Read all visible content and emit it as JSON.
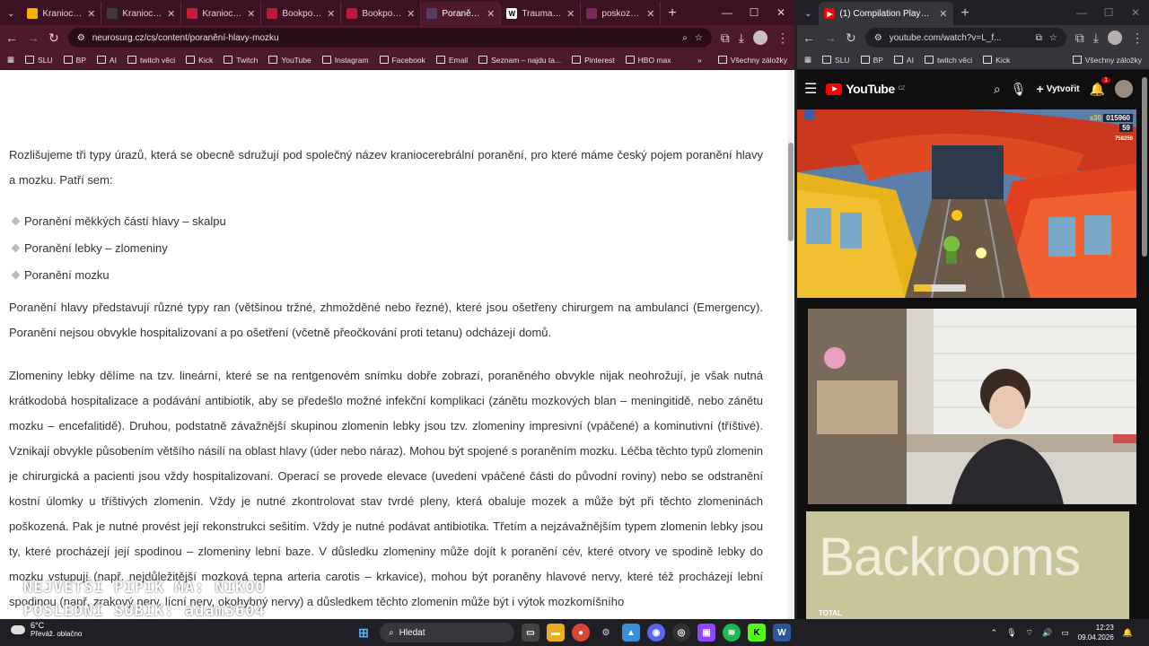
{
  "left_browser": {
    "tabs": [
      {
        "label": "Kraniocereb",
        "color": "#f5b400",
        "glyph": "",
        "active": false
      },
      {
        "label": "Kraniocereb",
        "color": "#3a3a3a",
        "glyph": "",
        "active": false
      },
      {
        "label": "Kraniocereb",
        "color": "#c41e3a",
        "glyph": "",
        "active": false
      },
      {
        "label": "Bookport -",
        "color": "#c0183c",
        "glyph": "",
        "active": false
      },
      {
        "label": "Bookport -",
        "color": "#c0183c",
        "glyph": "",
        "active": false
      },
      {
        "label": "Poranění hl",
        "color": "#5a3a6a",
        "glyph": "",
        "active": true
      },
      {
        "label": "Traumatick",
        "color": "#ffffff",
        "glyph": "W",
        "active": false
      },
      {
        "label": "poskození",
        "color": "#7a2a5a",
        "glyph": "",
        "active": false
      }
    ],
    "url": "neurosurg.cz/cs/content/poranění-hlavy-mozku",
    "bookmarks": [
      "SLU",
      "BP",
      "AI",
      "twitch věci",
      "Kick",
      "Twitch",
      "YouTube",
      "Instagram",
      "Facebook",
      "Email",
      "Seznam – najdu ta...",
      "Pinterest",
      "HBO max"
    ],
    "all_bookmarks": "Všechny záložky"
  },
  "article": {
    "intro": "Rozlišujeme tři typy úrazů, která se obecně sdružují pod společný název kraniocerebrální poranění, pro které máme český pojem poranění hlavy a mozku. Patří sem:",
    "list": [
      "Poranění měkkých částí hlavy – skalpu",
      "Poranění lebky – zlomeniny",
      "Poranění mozku"
    ],
    "p2": "Poranění hlavy představují různé typy ran (většinou tržné, zhmožděné nebo řezné), které jsou ošetřeny chirurgem na ambulanci (Emergency). Poranění nejsou obvykle hospitalizovaní a po ošetření (včetně přeočkování proti tetanu) odcházejí domů.",
    "p3": "Zlomeniny lebky dělíme na tzv. lineární, které se na rentgenovém snímku dobře zobrazí, poraněného obvykle nijak neohrožují, je však nutná krátkodobá hospitalizace a podávání antibiotik, aby se předešlo možné infekční komplikaci (zánětu mozkových blan – meningitidě, nebo zánětu mozku – encefalitidě). Druhou, podstatně závažnější skupinou zlomenin lebky jsou tzv. zlomeniny impresivní (vpáčené) a kominutivní (tříštivé). Vznikají obvykle působením většího násilí na oblast hlavy (úder nebo náraz). Mohou být spojené s poraněním mozku. Léčba těchto typů zlomenin je chirurgická a pacienti jsou vždy hospitalizovaní. Operací se provede elevace (uvedení vpáčené části do původní roviny) nebo se odstranění kostní úlomky u tříštivých zlomenin. Vždy je nutné zkontrolovat stav tvrdé pleny, která obaluje mozek a může být při těchto zlomeninách poškozená. Pak je nutné provést její rekonstrukci sešitím. Vždy je nutné podávat antibiotika. Třetím a nejzávažnějším typem zlomenin lebky jsou ty, které procházejí její spodinou – zlomeniny lební baze. V důsledku zlomeniny může dojít k poranění cév, které otvory ve spodině lebky do mozku vstupují (např. nejdůležitější mozková tepna arteria carotis – krkavice), mohou být poraněny hlavové nervy, které též procházejí lební spodinou (např. zrakový nerv, lícní nerv, okohybný nervy) a důsledkem těchto zlomenin může být i výtok mozkomíšního"
  },
  "stream_overlay": {
    "line1": "NEJVĚTŠÍ PIPÍK MÁ: NIKOO",
    "line2": "POSLEDNÍ SUBÍK: adam3604"
  },
  "right_browser": {
    "tab_title": "(1) Compilation PlayGame Sub",
    "url": "youtube.com/watch?v=L_f...",
    "bookmarks": [
      "SLU",
      "BP",
      "AI",
      "twitch věci",
      "Kick"
    ],
    "all_bookmarks": "Všechny záložky",
    "yt_logo": "YouTube",
    "yt_region": "CZ",
    "create_label": "Vytvořit",
    "notif_count": "1",
    "game_hud": {
      "mult": "x30",
      "score": "015960",
      "coins": "59",
      "side": "758250"
    },
    "backrooms_title": "Backrooms",
    "backrooms_sub": "TOTAL"
  },
  "taskbar": {
    "temp": "6°C",
    "weather": "Převáž. oblačno",
    "search": "Hledat",
    "time": "12:23",
    "date": "09.04.2026"
  }
}
